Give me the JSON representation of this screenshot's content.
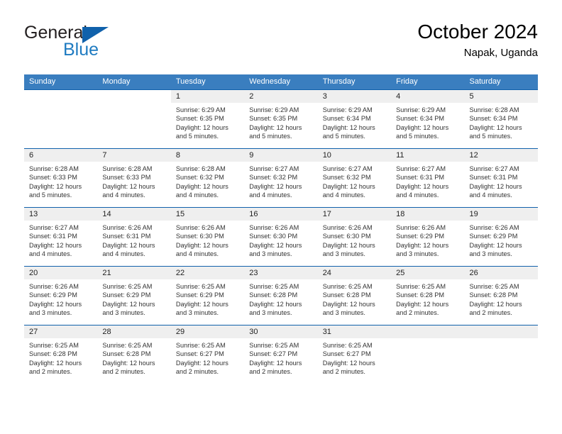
{
  "brand": {
    "word_one": "General",
    "word_two": "Blue",
    "triangle_icon": "triangle-logo-icon",
    "accent_color": "#1061ab",
    "blue_text_color": "#1f7bc1"
  },
  "header": {
    "title": "October 2024",
    "subtitle": "Napak, Uganda"
  },
  "theme": {
    "header_row_bg": "#3a7ebf",
    "day_band_bg": "#efefef",
    "grid_line": "#1061ab",
    "text": "#333333"
  },
  "weekdays": [
    "Sunday",
    "Monday",
    "Tuesday",
    "Wednesday",
    "Thursday",
    "Friday",
    "Saturday"
  ],
  "labels": {
    "sunrise_prefix": "Sunrise:",
    "sunset_prefix": "Sunset:",
    "daylight_prefix": "Daylight:"
  },
  "weeks": [
    [
      {
        "blank": true
      },
      {
        "blank": true
      },
      {
        "day": "1",
        "line1": "Sunrise: 6:29 AM",
        "line2": "Sunset: 6:35 PM",
        "line3": "Daylight: 12 hours",
        "line4": "and 5 minutes."
      },
      {
        "day": "2",
        "line1": "Sunrise: 6:29 AM",
        "line2": "Sunset: 6:35 PM",
        "line3": "Daylight: 12 hours",
        "line4": "and 5 minutes."
      },
      {
        "day": "3",
        "line1": "Sunrise: 6:29 AM",
        "line2": "Sunset: 6:34 PM",
        "line3": "Daylight: 12 hours",
        "line4": "and 5 minutes."
      },
      {
        "day": "4",
        "line1": "Sunrise: 6:29 AM",
        "line2": "Sunset: 6:34 PM",
        "line3": "Daylight: 12 hours",
        "line4": "and 5 minutes."
      },
      {
        "day": "5",
        "line1": "Sunrise: 6:28 AM",
        "line2": "Sunset: 6:34 PM",
        "line3": "Daylight: 12 hours",
        "line4": "and 5 minutes."
      }
    ],
    [
      {
        "day": "6",
        "line1": "Sunrise: 6:28 AM",
        "line2": "Sunset: 6:33 PM",
        "line3": "Daylight: 12 hours",
        "line4": "and 5 minutes."
      },
      {
        "day": "7",
        "line1": "Sunrise: 6:28 AM",
        "line2": "Sunset: 6:33 PM",
        "line3": "Daylight: 12 hours",
        "line4": "and 4 minutes."
      },
      {
        "day": "8",
        "line1": "Sunrise: 6:28 AM",
        "line2": "Sunset: 6:32 PM",
        "line3": "Daylight: 12 hours",
        "line4": "and 4 minutes."
      },
      {
        "day": "9",
        "line1": "Sunrise: 6:27 AM",
        "line2": "Sunset: 6:32 PM",
        "line3": "Daylight: 12 hours",
        "line4": "and 4 minutes."
      },
      {
        "day": "10",
        "line1": "Sunrise: 6:27 AM",
        "line2": "Sunset: 6:32 PM",
        "line3": "Daylight: 12 hours",
        "line4": "and 4 minutes."
      },
      {
        "day": "11",
        "line1": "Sunrise: 6:27 AM",
        "line2": "Sunset: 6:31 PM",
        "line3": "Daylight: 12 hours",
        "line4": "and 4 minutes."
      },
      {
        "day": "12",
        "line1": "Sunrise: 6:27 AM",
        "line2": "Sunset: 6:31 PM",
        "line3": "Daylight: 12 hours",
        "line4": "and 4 minutes."
      }
    ],
    [
      {
        "day": "13",
        "line1": "Sunrise: 6:27 AM",
        "line2": "Sunset: 6:31 PM",
        "line3": "Daylight: 12 hours",
        "line4": "and 4 minutes."
      },
      {
        "day": "14",
        "line1": "Sunrise: 6:26 AM",
        "line2": "Sunset: 6:31 PM",
        "line3": "Daylight: 12 hours",
        "line4": "and 4 minutes."
      },
      {
        "day": "15",
        "line1": "Sunrise: 6:26 AM",
        "line2": "Sunset: 6:30 PM",
        "line3": "Daylight: 12 hours",
        "line4": "and 4 minutes."
      },
      {
        "day": "16",
        "line1": "Sunrise: 6:26 AM",
        "line2": "Sunset: 6:30 PM",
        "line3": "Daylight: 12 hours",
        "line4": "and 3 minutes."
      },
      {
        "day": "17",
        "line1": "Sunrise: 6:26 AM",
        "line2": "Sunset: 6:30 PM",
        "line3": "Daylight: 12 hours",
        "line4": "and 3 minutes."
      },
      {
        "day": "18",
        "line1": "Sunrise: 6:26 AM",
        "line2": "Sunset: 6:29 PM",
        "line3": "Daylight: 12 hours",
        "line4": "and 3 minutes."
      },
      {
        "day": "19",
        "line1": "Sunrise: 6:26 AM",
        "line2": "Sunset: 6:29 PM",
        "line3": "Daylight: 12 hours",
        "line4": "and 3 minutes."
      }
    ],
    [
      {
        "day": "20",
        "line1": "Sunrise: 6:26 AM",
        "line2": "Sunset: 6:29 PM",
        "line3": "Daylight: 12 hours",
        "line4": "and 3 minutes."
      },
      {
        "day": "21",
        "line1": "Sunrise: 6:25 AM",
        "line2": "Sunset: 6:29 PM",
        "line3": "Daylight: 12 hours",
        "line4": "and 3 minutes."
      },
      {
        "day": "22",
        "line1": "Sunrise: 6:25 AM",
        "line2": "Sunset: 6:29 PM",
        "line3": "Daylight: 12 hours",
        "line4": "and 3 minutes."
      },
      {
        "day": "23",
        "line1": "Sunrise: 6:25 AM",
        "line2": "Sunset: 6:28 PM",
        "line3": "Daylight: 12 hours",
        "line4": "and 3 minutes."
      },
      {
        "day": "24",
        "line1": "Sunrise: 6:25 AM",
        "line2": "Sunset: 6:28 PM",
        "line3": "Daylight: 12 hours",
        "line4": "and 3 minutes."
      },
      {
        "day": "25",
        "line1": "Sunrise: 6:25 AM",
        "line2": "Sunset: 6:28 PM",
        "line3": "Daylight: 12 hours",
        "line4": "and 2 minutes."
      },
      {
        "day": "26",
        "line1": "Sunrise: 6:25 AM",
        "line2": "Sunset: 6:28 PM",
        "line3": "Daylight: 12 hours",
        "line4": "and 2 minutes."
      }
    ],
    [
      {
        "day": "27",
        "line1": "Sunrise: 6:25 AM",
        "line2": "Sunset: 6:28 PM",
        "line3": "Daylight: 12 hours",
        "line4": "and 2 minutes."
      },
      {
        "day": "28",
        "line1": "Sunrise: 6:25 AM",
        "line2": "Sunset: 6:28 PM",
        "line3": "Daylight: 12 hours",
        "line4": "and 2 minutes."
      },
      {
        "day": "29",
        "line1": "Sunrise: 6:25 AM",
        "line2": "Sunset: 6:27 PM",
        "line3": "Daylight: 12 hours",
        "line4": "and 2 minutes."
      },
      {
        "day": "30",
        "line1": "Sunrise: 6:25 AM",
        "line2": "Sunset: 6:27 PM",
        "line3": "Daylight: 12 hours",
        "line4": "and 2 minutes."
      },
      {
        "day": "31",
        "line1": "Sunrise: 6:25 AM",
        "line2": "Sunset: 6:27 PM",
        "line3": "Daylight: 12 hours",
        "line4": "and 2 minutes."
      },
      {
        "empty": true
      },
      {
        "empty": true
      }
    ]
  ]
}
